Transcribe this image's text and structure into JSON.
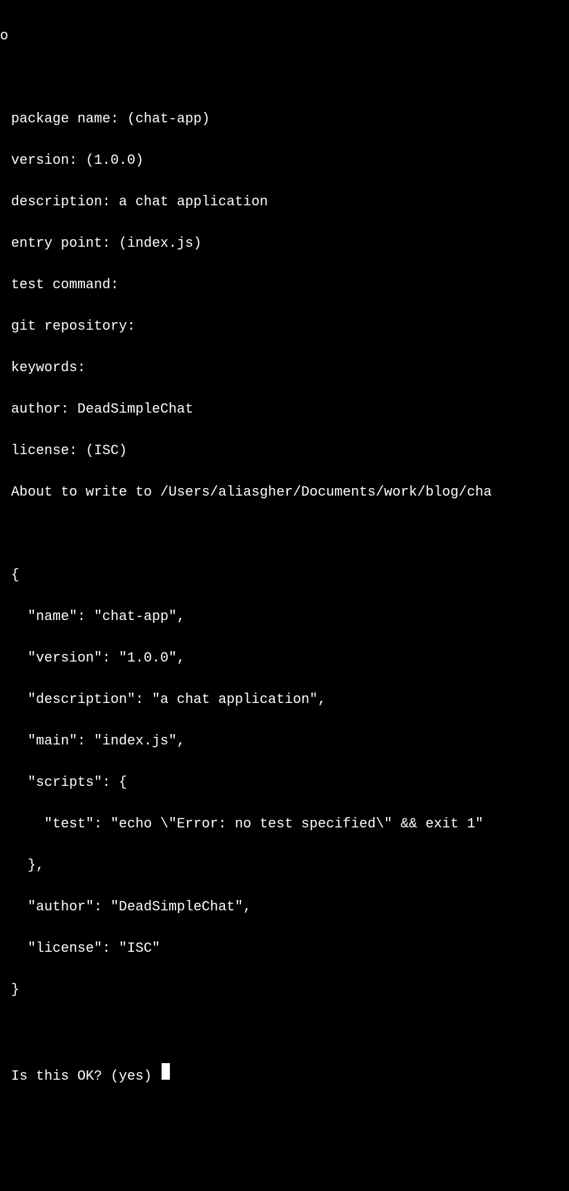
{
  "edge_char": "o",
  "prompts": {
    "package_name": "package name: (chat-app)",
    "version": "version: (1.0.0)",
    "description": "description: a chat application",
    "entry_point": "entry point: (index.js)",
    "test_command": "test command:",
    "git_repository": "git repository:",
    "keywords": "keywords:",
    "author": "author: DeadSimpleChat",
    "license": "license: (ISC)",
    "about_to_write": "About to write to /Users/aliasgher/Documents/work/blog/cha"
  },
  "json_output": {
    "open_brace": "{",
    "name_line": "  \"name\": \"chat-app\",",
    "version_line": "  \"version\": \"1.0.0\",",
    "description_line": "  \"description\": \"a chat application\",",
    "main_line": "  \"main\": \"index.js\",",
    "scripts_open": "  \"scripts\": {",
    "test_line": "    \"test\": \"echo \\\"Error: no test specified\\\" && exit 1\"",
    "scripts_close": "  },",
    "author_line": "  \"author\": \"DeadSimpleChat\",",
    "license_line": "  \"license\": \"ISC\"",
    "close_brace": "}"
  },
  "confirm_prompt": "Is this OK? (yes) "
}
